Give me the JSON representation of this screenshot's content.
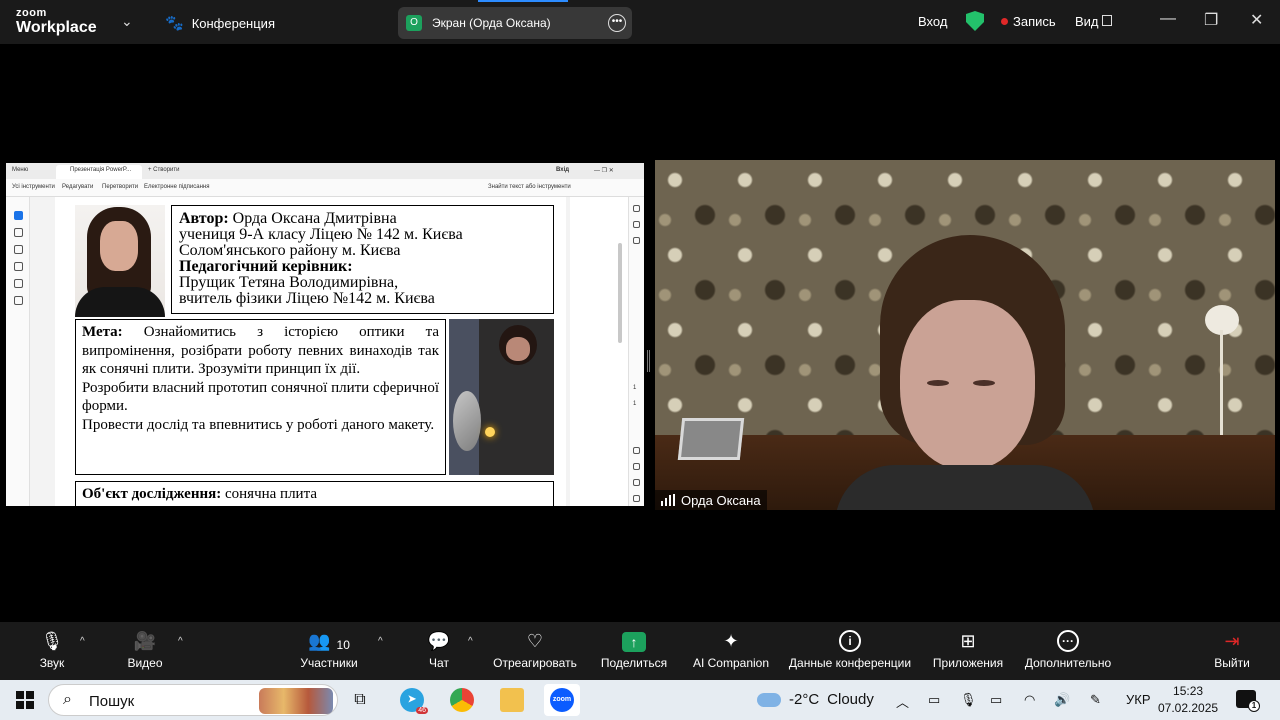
{
  "topbar": {
    "logo_line1": "zoom",
    "logo_line2": "Workplace",
    "conference_label": "Конференция",
    "share_indicator": "Экран (Орда Оксана)",
    "share_initial": "О",
    "signin_label": "Вход",
    "record_label": "Запись",
    "view_label": "Вид"
  },
  "shared_screen": {
    "tabs": [
      "Меню",
      "Презентація PowerP...",
      "+ Створити"
    ],
    "signin": "Вхід",
    "toolbar": [
      "Усі інструменти",
      "Редагувати",
      "Перетворити",
      "Електронне підписання"
    ],
    "find_text": "Знайти текст або інструменти",
    "page_numbers": [
      "1",
      "1"
    ],
    "document": {
      "author_label": "Автор:",
      "author_name": "Орда Оксана Дмитрівна",
      "author_line2": "учениця  9-А  класу Ліцею № 142 м. Києва",
      "author_line3": "Солом'янського району м. Києва",
      "supervisor_label": "Педагогічний керівник:",
      "supervisor_name": "Прущик Тетяна Володимирівна,",
      "supervisor_line2": "вчитель фізики Ліцею №142 м. Києва",
      "goal_label": "Мета:",
      "goal_text1": "Ознайомитись з історією оптики та випромінення, розібрати роботу певних винаходів так як сонячні плити. Зрозуміти принцип їх дії.",
      "goal_text2": "Розробити власний прототип сонячної плити сферичної форми.",
      "goal_text3": "Провести дослід та впевнитись у роботі даного макету.",
      "object_label": "Об'єкт дослідження:",
      "object_text": "сонячна плита"
    }
  },
  "participant": {
    "name": "Орда Оксана"
  },
  "controls": {
    "audio": "Звук",
    "video": "Видео",
    "participants": "Участники",
    "participants_count": "10",
    "chat": "Чат",
    "react": "Отреагировать",
    "share": "Поделиться",
    "ai": "AI Companion",
    "info": "Данные конференции",
    "apps": "Приложения",
    "more": "Дополнительно",
    "leave": "Выйти"
  },
  "taskbar": {
    "search_placeholder": "Пошук",
    "telegram_badge": "46",
    "zoom_label": "zoom",
    "weather_temp": "-2°C",
    "weather_desc": "Cloudy",
    "lang": "УКР",
    "time": "15:23",
    "date": "07.02.2025",
    "notif_count": "1"
  }
}
